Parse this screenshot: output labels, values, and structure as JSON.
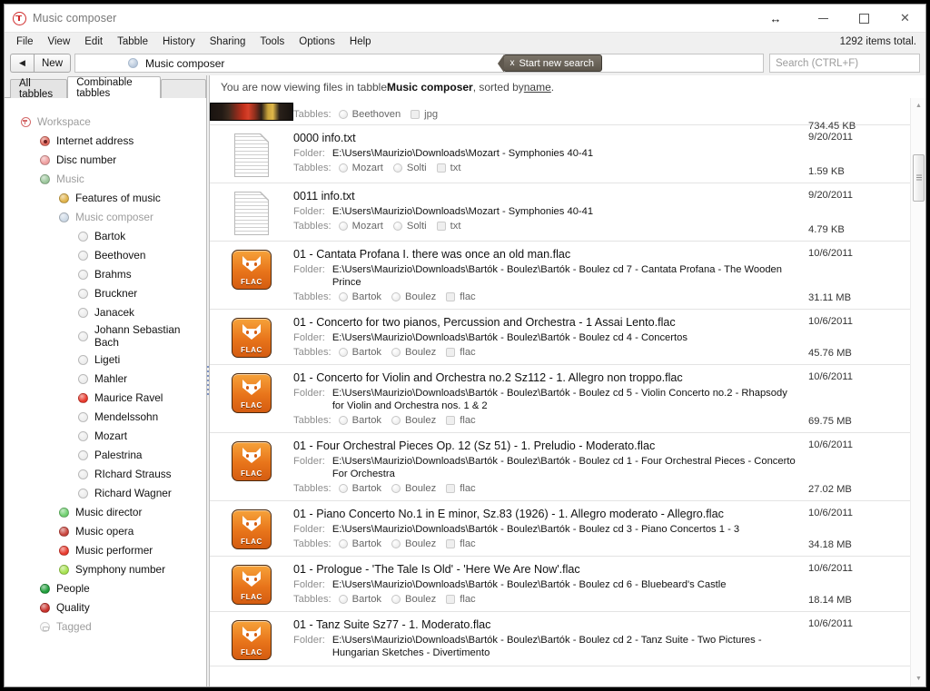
{
  "window": {
    "title": "Music composer",
    "app_icon": "tabbles-logo-icon",
    "resize_icon": "↔",
    "minimize_icon": "minimize-icon",
    "maximize_icon": "maximize-icon",
    "close_icon": "✕"
  },
  "menubar": {
    "items": [
      "File",
      "View",
      "Edit",
      "Tabble",
      "History",
      "Sharing",
      "Tools",
      "Options",
      "Help"
    ],
    "items_total": "1292 items total."
  },
  "navbar": {
    "back_icon": "◀",
    "new_label": "New",
    "breadcrumb": "Music composer",
    "breadcrumb_icon": "tabble-circle-icon",
    "new_search_x": "x",
    "new_search_label": "Start new search",
    "search_placeholder": "Search (CTRL+F)"
  },
  "left": {
    "tabs": [
      {
        "label": "All tabbles",
        "active": false
      },
      {
        "label": "Combinable tabbles",
        "active": true
      }
    ],
    "tree": [
      {
        "label": "Workspace",
        "indent": 0,
        "icon": "ring",
        "color": "#d46a6a",
        "dim": true
      },
      {
        "label": "Internet address",
        "indent": 1,
        "icon": "sel",
        "color": "#e06a5e",
        "dim": false
      },
      {
        "label": "Disc number",
        "indent": 1,
        "icon": "dot",
        "color": "#ef9f9f",
        "dim": false
      },
      {
        "label": "Music",
        "indent": 1,
        "icon": "dot",
        "color": "#9cc79c",
        "dim": true
      },
      {
        "label": "Features of music",
        "indent": 2,
        "icon": "dot",
        "color": "#e0b34a",
        "dim": false
      },
      {
        "label": "Music composer",
        "indent": 2,
        "icon": "dot",
        "color": "#cdd9e6",
        "dim": true
      },
      {
        "label": "Bartok",
        "indent": 3,
        "icon": "dot",
        "color": "#ededed",
        "dim": false
      },
      {
        "label": "Beethoven",
        "indent": 3,
        "icon": "dot",
        "color": "#ededed",
        "dim": false
      },
      {
        "label": "Brahms",
        "indent": 3,
        "icon": "dot",
        "color": "#ededed",
        "dim": false
      },
      {
        "label": "Bruckner",
        "indent": 3,
        "icon": "dot",
        "color": "#ededed",
        "dim": false
      },
      {
        "label": "Janacek",
        "indent": 3,
        "icon": "dot",
        "color": "#ededed",
        "dim": false
      },
      {
        "label": "Johann Sebastian Bach",
        "indent": 3,
        "icon": "dot",
        "color": "#ededed",
        "dim": false,
        "wrap": true
      },
      {
        "label": "Ligeti",
        "indent": 3,
        "icon": "dot",
        "color": "#ededed",
        "dim": false
      },
      {
        "label": "Mahler",
        "indent": 3,
        "icon": "dot",
        "color": "#ededed",
        "dim": false
      },
      {
        "label": "Maurice Ravel",
        "indent": 3,
        "icon": "dot",
        "color": "#e8392c",
        "dim": false
      },
      {
        "label": "Mendelssohn",
        "indent": 3,
        "icon": "dot",
        "color": "#ededed",
        "dim": false
      },
      {
        "label": "Mozart",
        "indent": 3,
        "icon": "dot",
        "color": "#ededed",
        "dim": false
      },
      {
        "label": "Palestrina",
        "indent": 3,
        "icon": "dot",
        "color": "#ededed",
        "dim": false
      },
      {
        "label": "RIchard Strauss",
        "indent": 3,
        "icon": "dot",
        "color": "#ededed",
        "dim": false
      },
      {
        "label": "Richard Wagner",
        "indent": 3,
        "icon": "dot",
        "color": "#ededed",
        "dim": false
      },
      {
        "label": "Music director",
        "indent": 2,
        "icon": "dot",
        "color": "#6fd06f",
        "dim": false
      },
      {
        "label": "Music opera",
        "indent": 2,
        "icon": "dot",
        "color": "#c8443c",
        "dim": false
      },
      {
        "label": "Music performer",
        "indent": 2,
        "icon": "dot",
        "color": "#e8392c",
        "dim": false
      },
      {
        "label": "Symphony number",
        "indent": 2,
        "icon": "dot",
        "color": "#a6e24f",
        "dim": false
      },
      {
        "label": "People",
        "indent": 1,
        "icon": "dot",
        "color": "#1f9d3a",
        "dim": false
      },
      {
        "label": "Quality",
        "indent": 1,
        "icon": "dot",
        "color": "#c8302a",
        "dim": false
      },
      {
        "label": "Tagged",
        "indent": 1,
        "icon": "tagged",
        "color": "#e8e8e8",
        "dim": true
      }
    ]
  },
  "main": {
    "status_prefix": "You are now viewing files in tabble ",
    "status_tabble": "Music composer",
    "status_mid": ", sorted by ",
    "status_sort": "name",
    "status_suffix": ".",
    "tabbles_label": "Tabbles:",
    "folder_label": "Folder:",
    "rows": [
      {
        "icon": "image-thumbnail",
        "partial": true,
        "name": "",
        "folder": "",
        "tags": [
          {
            "text": "Beethoven",
            "shape": "circle"
          },
          {
            "text": "jpg",
            "shape": "square"
          }
        ],
        "date": "",
        "size": "734.45 KB"
      },
      {
        "icon": "txt-document-icon",
        "partial": false,
        "name": "0000 info.txt",
        "folder": "E:\\Users\\Maurizio\\Downloads\\Mozart - Symphonies 40-41",
        "tags": [
          {
            "text": "Mozart",
            "shape": "circle"
          },
          {
            "text": "Solti",
            "shape": "circle"
          },
          {
            "text": "txt",
            "shape": "square"
          }
        ],
        "date": "9/20/2011",
        "size": "1.59 KB"
      },
      {
        "icon": "txt-document-icon",
        "partial": false,
        "name": "0011 info.txt",
        "folder": "E:\\Users\\Maurizio\\Downloads\\Mozart - Symphonies 40-41",
        "tags": [
          {
            "text": "Mozart",
            "shape": "circle"
          },
          {
            "text": "Solti",
            "shape": "circle"
          },
          {
            "text": "txt",
            "shape": "square"
          }
        ],
        "date": "9/20/2011",
        "size": "4.79 KB"
      },
      {
        "icon": "flac-audio-icon",
        "partial": false,
        "name": "01 - Cantata Profana I. there was once an old man.flac",
        "folder": "E:\\Users\\Maurizio\\Downloads\\Bartók - Boulez\\Bartók - Boulez  cd 7 - Cantata Profana - The Wooden Prince",
        "tags": [
          {
            "text": "Bartok",
            "shape": "circle"
          },
          {
            "text": "Boulez",
            "shape": "circle"
          },
          {
            "text": "flac",
            "shape": "square"
          }
        ],
        "date": "10/6/2011",
        "size": "31.11 MB"
      },
      {
        "icon": "flac-audio-icon",
        "partial": false,
        "name": "01 - Concerto for two pianos, Percussion and Orchestra - 1 Assai Lento.flac",
        "folder": "E:\\Users\\Maurizio\\Downloads\\Bartók - Boulez\\Bartók - Boulez  cd 4 - Concertos",
        "tags": [
          {
            "text": "Bartok",
            "shape": "circle"
          },
          {
            "text": "Boulez",
            "shape": "circle"
          },
          {
            "text": "flac",
            "shape": "square"
          }
        ],
        "date": "10/6/2011",
        "size": "45.76 MB"
      },
      {
        "icon": "flac-audio-icon",
        "partial": false,
        "name": "01 - Concerto for Violin and Orchestra no.2 Sz112 - 1. Allegro non troppo.flac",
        "folder": "E:\\Users\\Maurizio\\Downloads\\Bartók - Boulez\\Bartók - Boulez  cd 5 - Violin Concerto no.2 - Rhapsody for Violin and Orchestra nos. 1 & 2",
        "tags": [
          {
            "text": "Bartok",
            "shape": "circle"
          },
          {
            "text": "Boulez",
            "shape": "circle"
          },
          {
            "text": "flac",
            "shape": "square"
          }
        ],
        "date": "10/6/2011",
        "size": "69.75 MB"
      },
      {
        "icon": "flac-audio-icon",
        "partial": false,
        "name": "01 - Four Orchestral Pieces Op. 12 (Sz 51) - 1. Preludio - Moderato.flac",
        "folder": "E:\\Users\\Maurizio\\Downloads\\Bartók - Boulez\\Bartók - Boulez  cd 1 - Four Orchestral Pieces - Concerto For Orchestra",
        "tags": [
          {
            "text": "Bartok",
            "shape": "circle"
          },
          {
            "text": "Boulez",
            "shape": "circle"
          },
          {
            "text": "flac",
            "shape": "square"
          }
        ],
        "date": "10/6/2011",
        "size": "27.02 MB"
      },
      {
        "icon": "flac-audio-icon",
        "partial": false,
        "name": "01 - Piano Concerto No.1 in E minor, Sz.83 (1926) - 1. Allegro moderato - Allegro.flac",
        "folder": "E:\\Users\\Maurizio\\Downloads\\Bartók - Boulez\\Bartók - Boulez  cd 3 - Piano Concertos 1 - 3",
        "tags": [
          {
            "text": "Bartok",
            "shape": "circle"
          },
          {
            "text": "Boulez",
            "shape": "circle"
          },
          {
            "text": "flac",
            "shape": "square"
          }
        ],
        "date": "10/6/2011",
        "size": "34.18 MB"
      },
      {
        "icon": "flac-audio-icon",
        "partial": false,
        "name": "01 - Prologue - 'The Tale Is Old' - 'Here We Are Now'.flac",
        "folder": "E:\\Users\\Maurizio\\Downloads\\Bartók - Boulez\\Bartók - Boulez  cd 6 - Bluebeard's Castle",
        "tags": [
          {
            "text": "Bartok",
            "shape": "circle"
          },
          {
            "text": "Boulez",
            "shape": "circle"
          },
          {
            "text": "flac",
            "shape": "square"
          }
        ],
        "date": "10/6/2011",
        "size": "18.14 MB"
      },
      {
        "icon": "flac-audio-icon",
        "partial": false,
        "name": "01 - Tanz Suite Sz77  - 1. Moderato.flac",
        "folder": "E:\\Users\\Maurizio\\Downloads\\Bartók - Boulez\\Bartók - Boulez  cd 2 - Tanz Suite - Two Pictures - Hungarian Sketches - Divertimento",
        "tags": [],
        "date": "10/6/2011",
        "size": ""
      }
    ],
    "scroll_up_icon": "▲",
    "scroll_down_icon": "▼"
  }
}
